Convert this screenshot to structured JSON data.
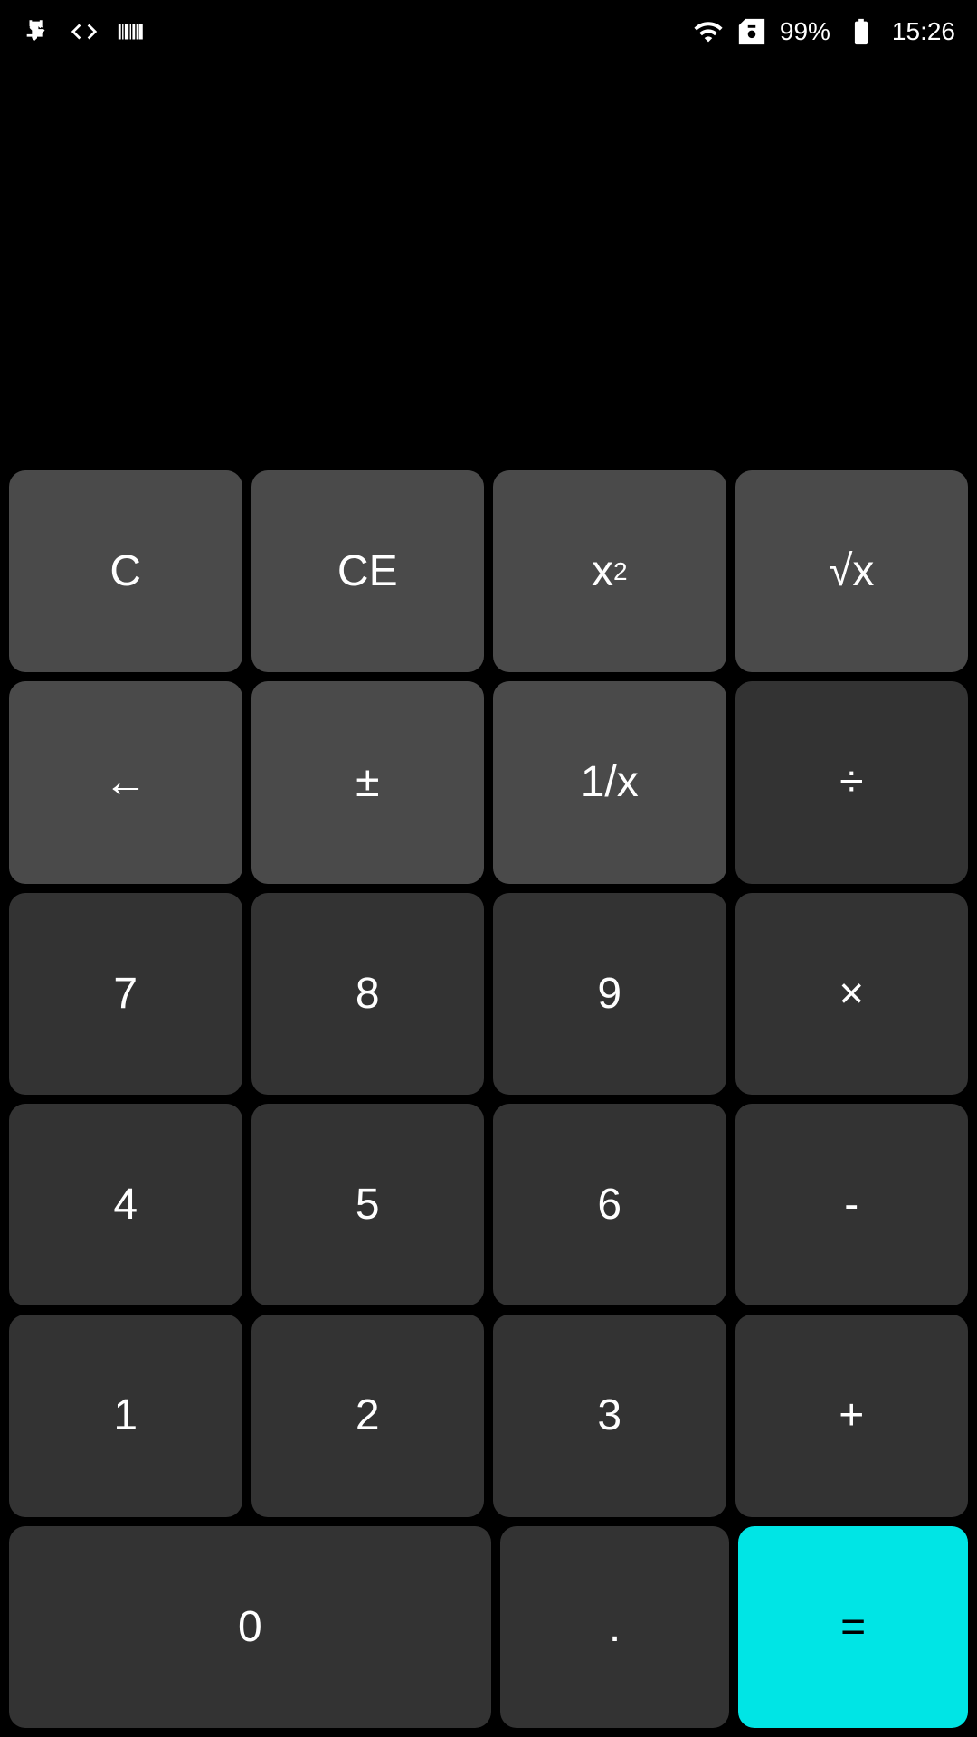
{
  "statusBar": {
    "battery": "99%",
    "time": "15:26"
  },
  "display": {
    "value": ""
  },
  "keypad": {
    "rows": [
      [
        {
          "id": "btn-c",
          "label": "C",
          "type": "function"
        },
        {
          "id": "btn-ce",
          "label": "CE",
          "type": "function"
        },
        {
          "id": "btn-x2",
          "label": "x²",
          "type": "function",
          "sup": true
        },
        {
          "id": "btn-sqrt",
          "label": "√x",
          "type": "function"
        }
      ],
      [
        {
          "id": "btn-back",
          "label": "←",
          "type": "function"
        },
        {
          "id": "btn-plusminus",
          "label": "±",
          "type": "function"
        },
        {
          "id": "btn-reciprocal",
          "label": "1/x",
          "type": "function"
        },
        {
          "id": "btn-divide",
          "label": "÷",
          "type": "operator"
        }
      ],
      [
        {
          "id": "btn-7",
          "label": "7",
          "type": "digit"
        },
        {
          "id": "btn-8",
          "label": "8",
          "type": "digit"
        },
        {
          "id": "btn-9",
          "label": "9",
          "type": "digit"
        },
        {
          "id": "btn-multiply",
          "label": "×",
          "type": "operator"
        }
      ],
      [
        {
          "id": "btn-4",
          "label": "4",
          "type": "digit"
        },
        {
          "id": "btn-5",
          "label": "5",
          "type": "digit"
        },
        {
          "id": "btn-6",
          "label": "6",
          "type": "digit"
        },
        {
          "id": "btn-minus",
          "label": "-",
          "type": "operator"
        }
      ],
      [
        {
          "id": "btn-1",
          "label": "1",
          "type": "digit"
        },
        {
          "id": "btn-2",
          "label": "2",
          "type": "digit"
        },
        {
          "id": "btn-3",
          "label": "3",
          "type": "digit"
        },
        {
          "id": "btn-plus",
          "label": "+",
          "type": "operator"
        }
      ],
      [
        {
          "id": "btn-0",
          "label": "0",
          "type": "digit",
          "wide": true
        },
        {
          "id": "btn-dot",
          "label": ".",
          "type": "digit"
        },
        {
          "id": "btn-equals",
          "label": "=",
          "type": "equals"
        }
      ]
    ]
  }
}
